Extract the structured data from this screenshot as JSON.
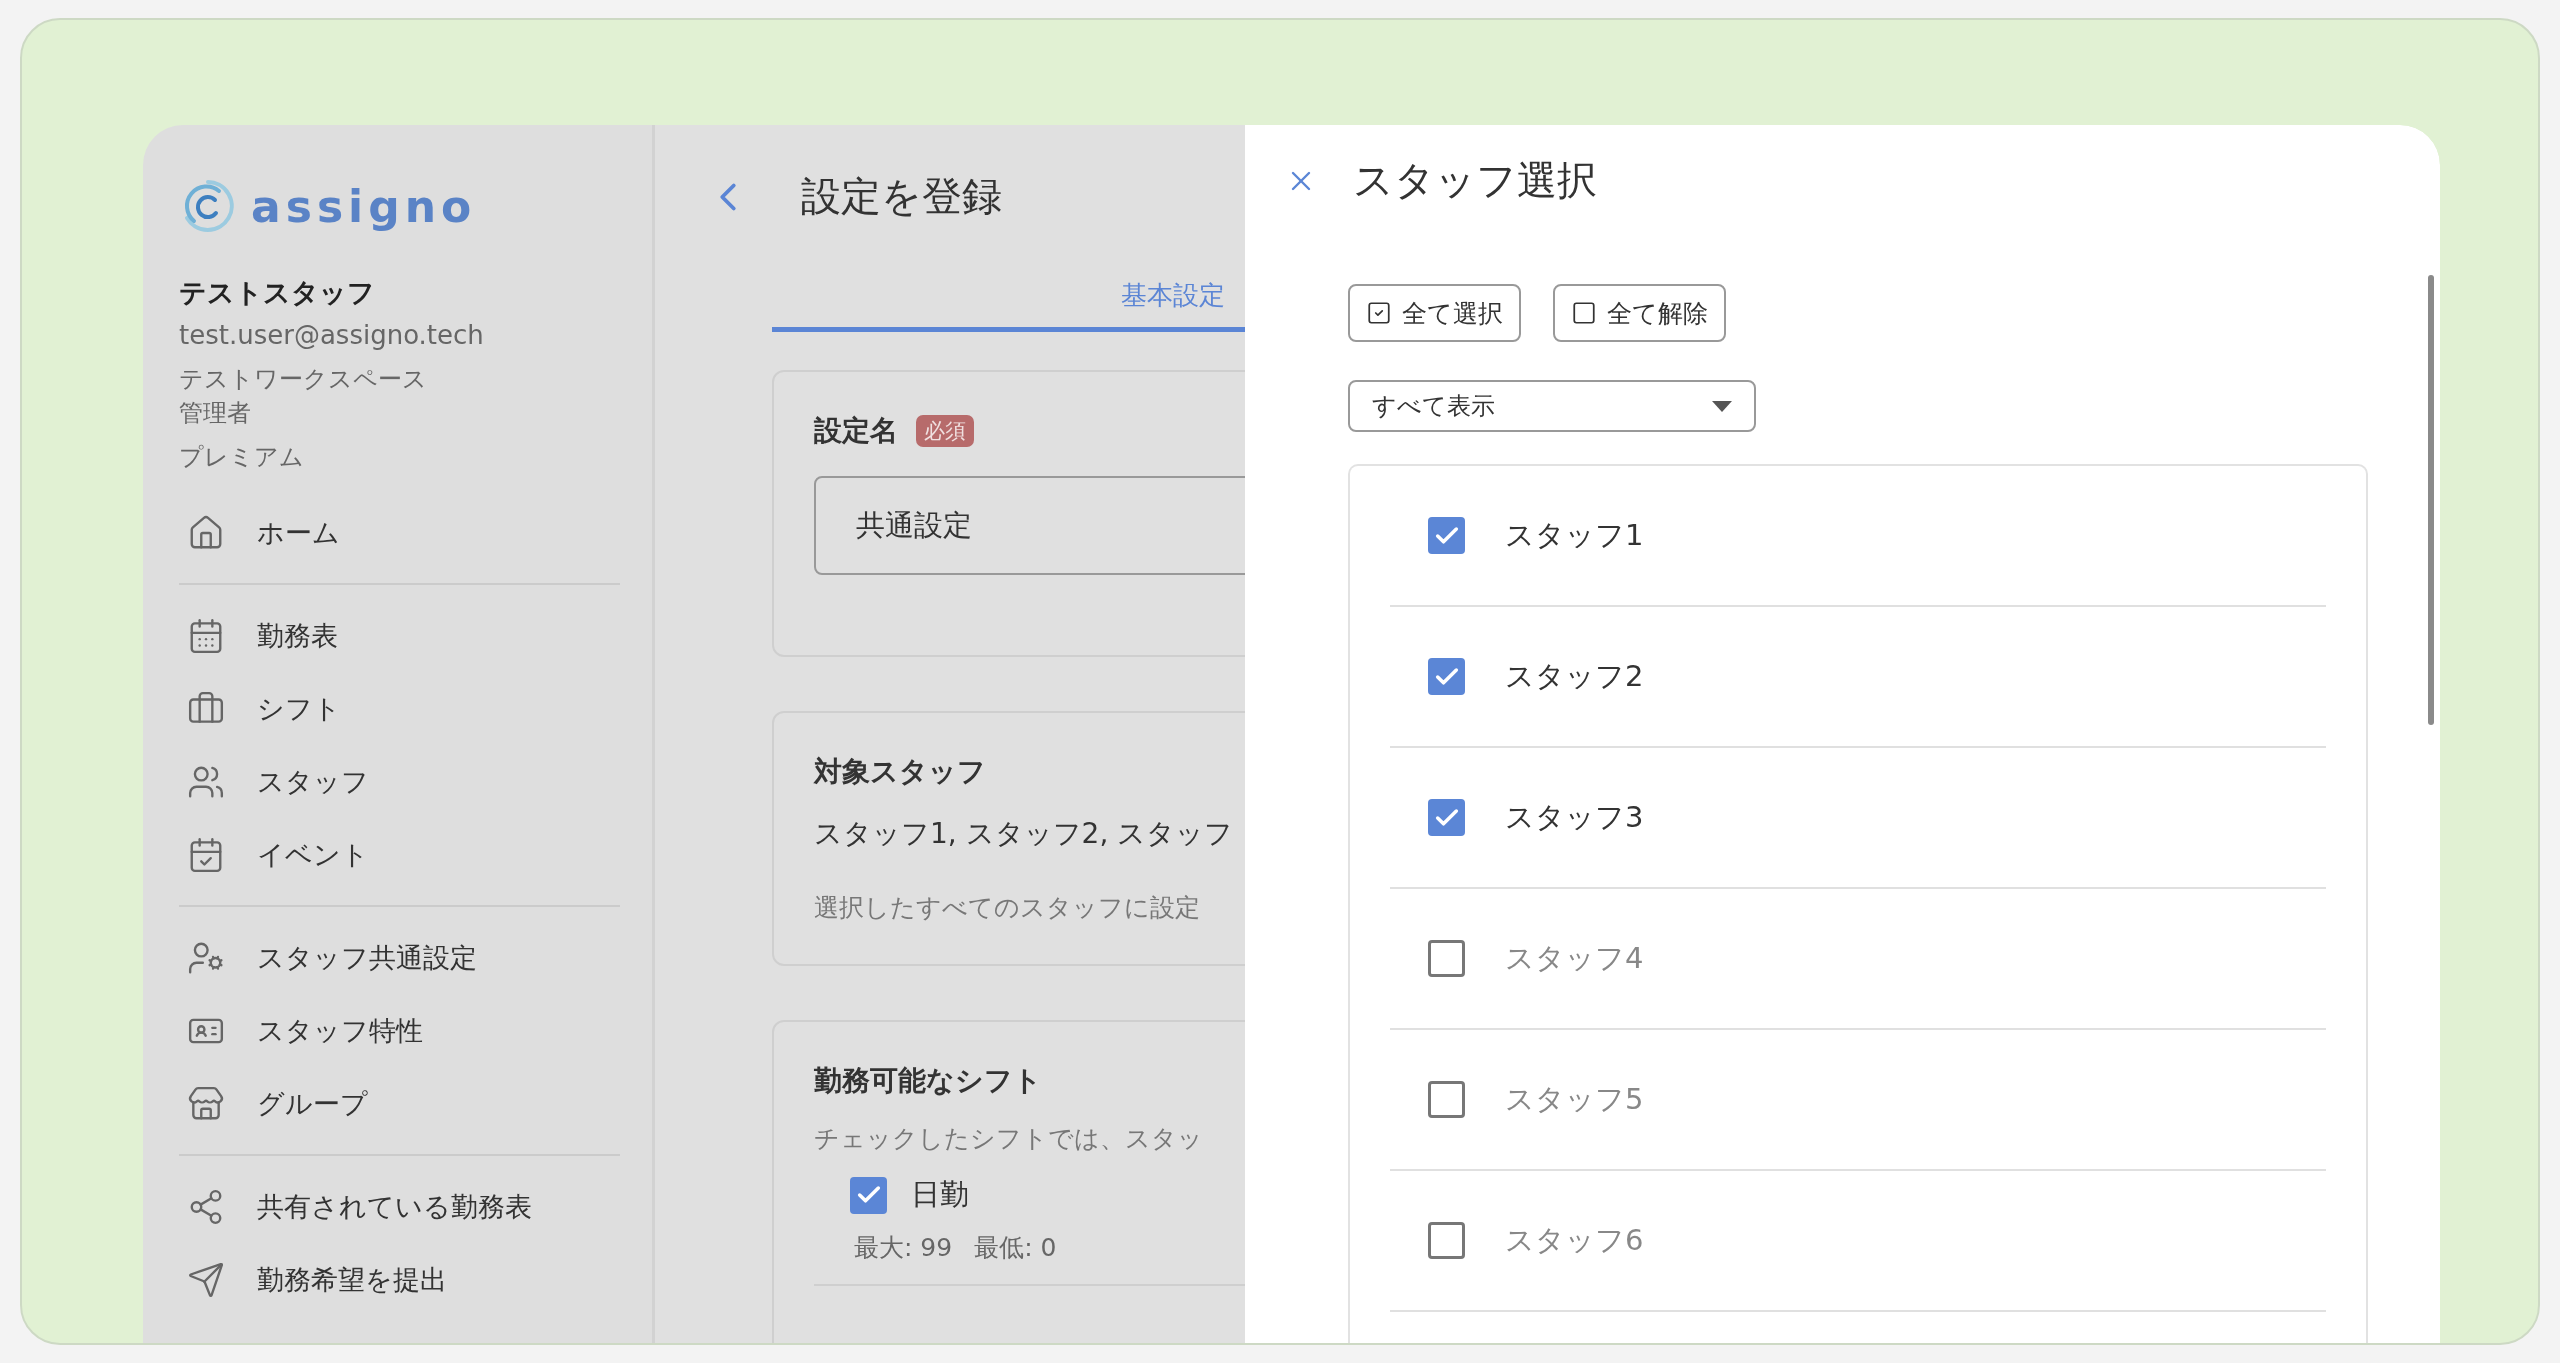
{
  "sidebar": {
    "logo": "assigno",
    "user": {
      "name": "テストスタッフ",
      "email": "test.user@assigno.tech",
      "workspace": "テストワークスペース",
      "role": "管理者",
      "plan": "プレミアム"
    },
    "sections": [
      {
        "items": [
          "ホーム"
        ]
      },
      {
        "items": [
          "勤務表",
          "シフト",
          "スタッフ",
          "イベント"
        ]
      },
      {
        "items": [
          "スタッフ共通設定",
          "スタッフ特性",
          "グループ"
        ]
      },
      {
        "items": [
          "共有されている勤務表",
          "勤務希望を提出"
        ]
      }
    ]
  },
  "main": {
    "title": "設定を登録",
    "tabs": [
      {
        "label": "基本設定",
        "selected": true
      }
    ],
    "setting_name": {
      "label": "設定名",
      "badge": "必須",
      "value": "共通設定"
    },
    "target_staff": {
      "title": "対象スタッフ",
      "value": "スタッフ1, スタッフ2, スタッフ",
      "note": "選択したすべてのスタッフに設定"
    },
    "shifts_card": {
      "title": "勤務可能なシフト",
      "description": "チェックしたシフトでは、スタッ",
      "shifts": [
        {
          "label": "日勤",
          "checked": true,
          "max": "最大: 99",
          "min": "最低: 0"
        }
      ]
    }
  },
  "drawer": {
    "title": "スタッフ選択",
    "buttons": [
      {
        "kind": "check",
        "label": "全て選択"
      },
      {
        "kind": "clear",
        "label": "全て解除"
      }
    ],
    "filter": {
      "value": "すべて表示"
    },
    "staff": [
      {
        "name": "スタッフ1",
        "checked": true
      },
      {
        "name": "スタッフ2",
        "checked": true
      },
      {
        "name": "スタッフ3",
        "checked": true
      },
      {
        "name": "スタッフ4",
        "checked": false
      },
      {
        "name": "スタッフ5",
        "checked": false
      },
      {
        "name": "スタッフ6",
        "checked": false
      }
    ]
  }
}
